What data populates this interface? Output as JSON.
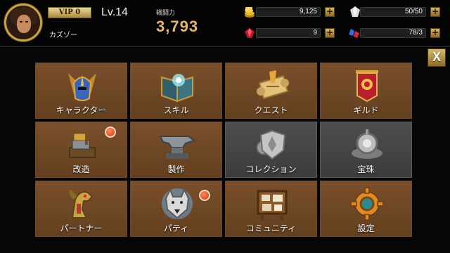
{
  "player": {
    "vip": "VIP 0",
    "level": "Lv.14",
    "name": "カズゾー",
    "power_label": "戦闘力",
    "power": "3,793"
  },
  "resources": [
    {
      "id": "gold",
      "icon": "gold-coins-icon",
      "value": "9,125",
      "plus": "+"
    },
    {
      "id": "stamina",
      "icon": "silver-crystal-icon",
      "value": "50/50",
      "plus": "+"
    },
    {
      "id": "ruby",
      "icon": "red-gem-icon",
      "value": "9",
      "plus": "+"
    },
    {
      "id": "gems",
      "icon": "blue-red-gems-icon",
      "value": "78/3",
      "plus": "+"
    }
  ],
  "close_label": "X",
  "menu": [
    {
      "label": "キャラクター",
      "icon": "winged-helmet-icon",
      "badge": false,
      "style": "brown"
    },
    {
      "label": "スキル",
      "icon": "spellbook-icon",
      "badge": false,
      "style": "brown"
    },
    {
      "label": "クエスト",
      "icon": "quest-scroll-icon",
      "badge": false,
      "style": "brown"
    },
    {
      "label": "ギルド",
      "icon": "guild-banner-icon",
      "badge": false,
      "style": "brown"
    },
    {
      "label": "改造",
      "icon": "forging-hammer-icon",
      "badge": true,
      "style": "brown"
    },
    {
      "label": "製作",
      "icon": "anvil-icon",
      "badge": false,
      "style": "brown"
    },
    {
      "label": "コレクション",
      "icon": "collection-shield-icon",
      "badge": false,
      "style": "grey"
    },
    {
      "label": "宝珠",
      "icon": "orb-gear-icon",
      "badge": false,
      "style": "grey"
    },
    {
      "label": "パートナー",
      "icon": "dragon-head-icon",
      "badge": false,
      "style": "brown"
    },
    {
      "label": "パティ",
      "icon": "wolf-party-icon",
      "badge": true,
      "style": "brown"
    },
    {
      "label": "コミュニティ",
      "icon": "notice-board-icon",
      "badge": false,
      "style": "brown"
    },
    {
      "label": "設定",
      "icon": "settings-gear-icon",
      "badge": false,
      "style": "brown"
    }
  ]
}
